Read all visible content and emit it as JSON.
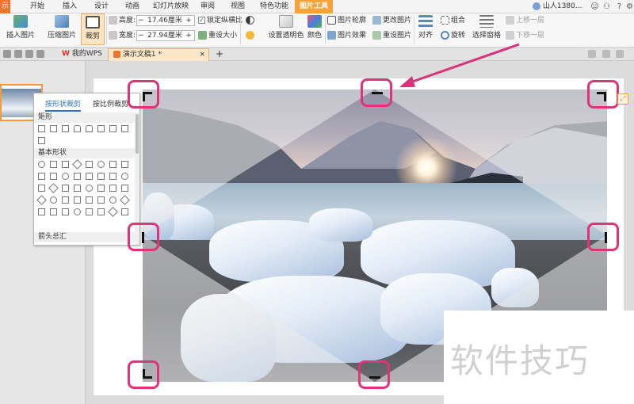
{
  "menu": {
    "file_label": "示",
    "tabs": [
      "开始",
      "插入",
      "设计",
      "动画",
      "幻灯片放映",
      "审阅",
      "视图",
      "特色功能"
    ],
    "active_tab": "图片工具",
    "account": "山人1380..."
  },
  "ribbon": {
    "insert_picture": "插入图片",
    "compress_picture": "压缩图片",
    "crop": "裁剪",
    "height_label": "高度:",
    "height_value": "17.46厘米",
    "width_label": "宽度:",
    "width_value": "27.94厘米",
    "lock_aspect": "锁定纵横比",
    "reset_size": "重设大小",
    "set_transparent": "设置透明色",
    "color": "颜色",
    "picture_outline": "图片轮廓",
    "picture_effect": "图片效果",
    "change_picture": "更改图片",
    "reset_picture": "重设图片",
    "align": "对齐",
    "rotate": "旋转",
    "group": "组合",
    "selection_pane": "选择窗格",
    "bring_forward": "上移一层",
    "send_backward": "下移一层",
    "minus": "−",
    "plus": "+"
  },
  "docbar": {
    "my_wps": "我的WPS",
    "doc_tab": "演示文稿1 *",
    "new_tab": "+"
  },
  "shape_panel": {
    "tab_shape_crop": "按形状裁剪",
    "tab_ratio_crop": "按比例裁剪",
    "cat_rect": "矩形",
    "cat_basic": "基本形状",
    "cat_arrows": "箭头总汇"
  },
  "watermark": "软件技巧",
  "colors": {
    "accent_orange": "#f7a237",
    "handle_pink": "#e0337a",
    "selected_tab_blue": "#2e75c9"
  }
}
